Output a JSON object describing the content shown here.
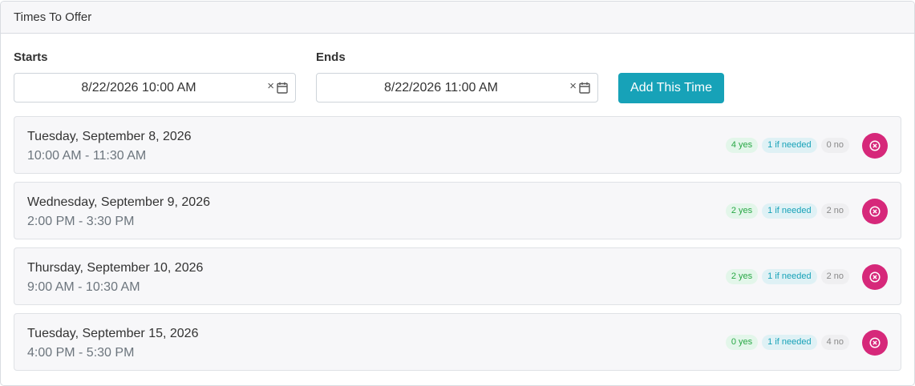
{
  "header": {
    "title": "Times To Offer"
  },
  "form": {
    "starts_label": "Starts",
    "starts_value": "8/22/2026 10:00 AM",
    "ends_label": "Ends",
    "ends_value": "8/22/2026 11:00 AM",
    "clear_glyph": "×",
    "add_label": "Add This Time"
  },
  "times": [
    {
      "date": "Tuesday, September 8, 2026",
      "range": "10:00 AM - 11:30 AM",
      "yes": "4 yes",
      "if_needed": "1 if needed",
      "no": "0 no"
    },
    {
      "date": "Wednesday, September 9, 2026",
      "range": "2:00 PM - 3:30 PM",
      "yes": "2 yes",
      "if_needed": "1 if needed",
      "no": "2 no"
    },
    {
      "date": "Thursday, September 10, 2026",
      "range": "9:00 AM - 10:30 AM",
      "yes": "2 yes",
      "if_needed": "1 if needed",
      "no": "2 no"
    },
    {
      "date": "Tuesday, September 15, 2026",
      "range": "4:00 PM - 5:30 PM",
      "yes": "0 yes",
      "if_needed": "1 if needed",
      "no": "4 no"
    }
  ],
  "icons": {
    "calendar": "calendar-icon",
    "clear": "close-icon",
    "remove": "remove-circle-icon"
  },
  "colors": {
    "primary": "#17a2b8",
    "danger": "#d6287a",
    "yes": "#28a745",
    "if_needed": "#17a2b8",
    "no": "#888888"
  }
}
